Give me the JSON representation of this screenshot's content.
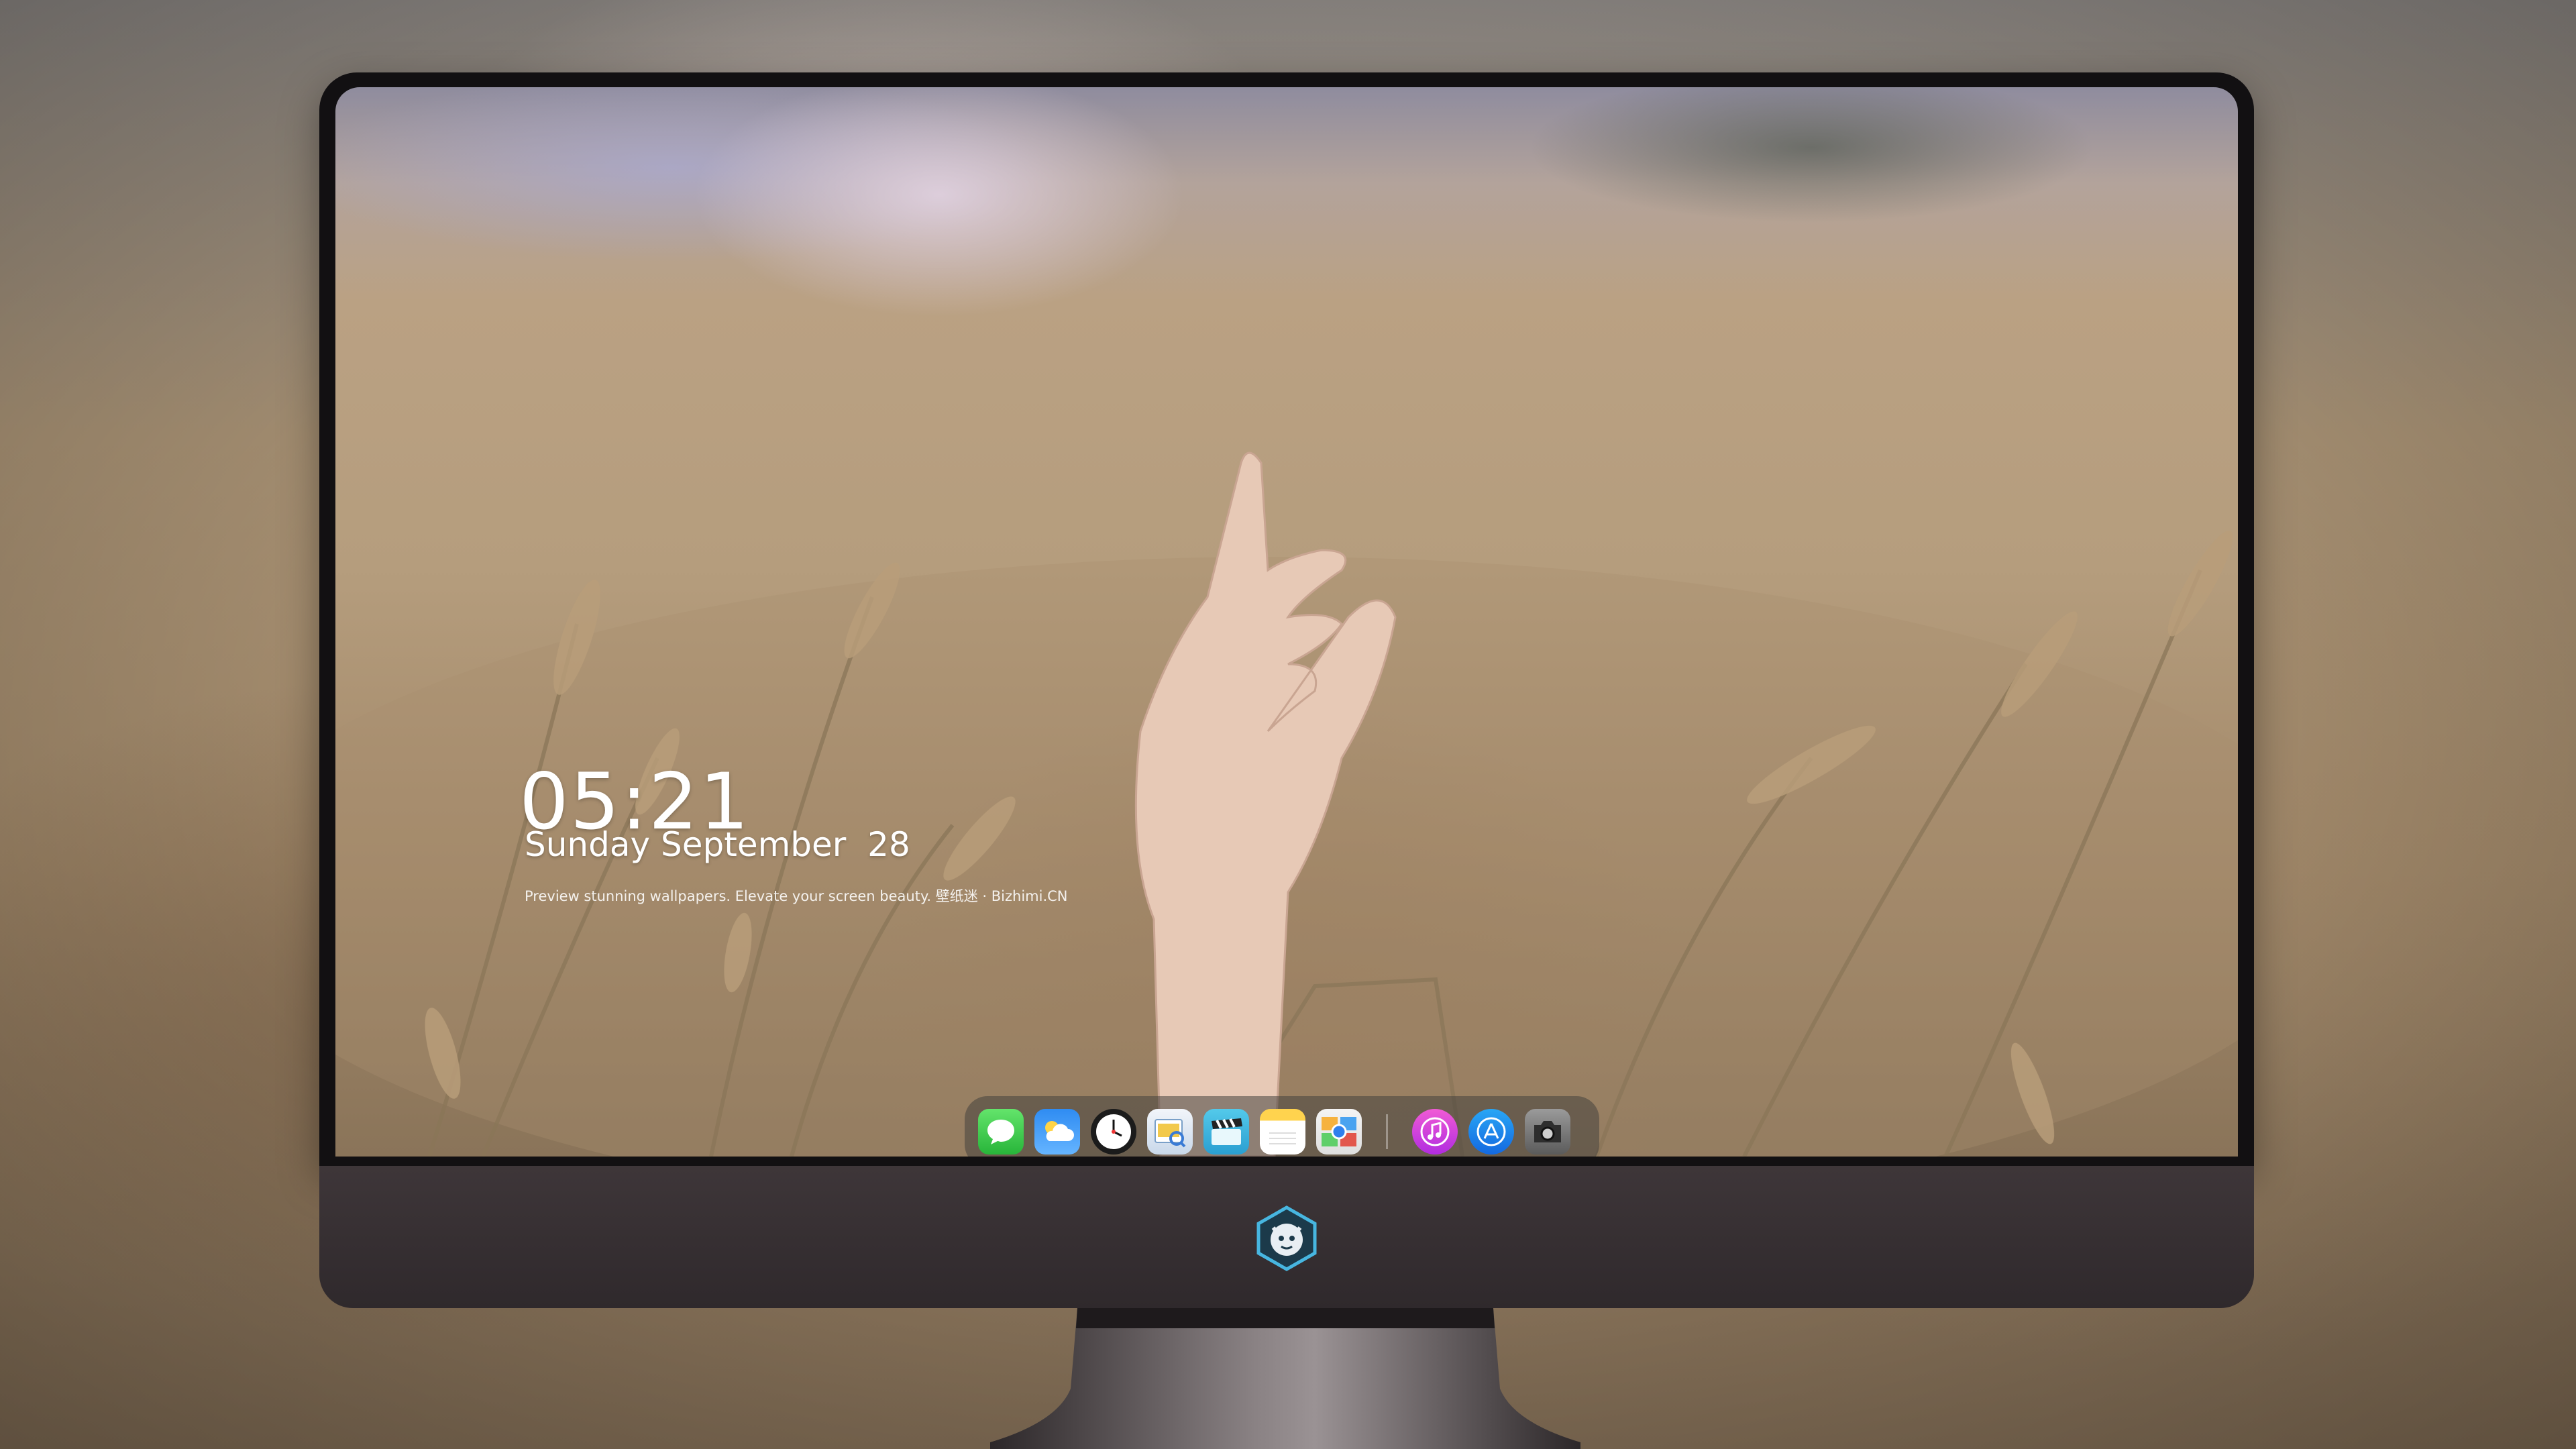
{
  "lock_screen": {
    "time": "05:21",
    "date": "Sunday September  28",
    "tagline": "Preview stunning wallpapers. Elevate your screen beauty. 壁纸迷 · Bizhimi.CN"
  },
  "dock": {
    "apps": [
      {
        "name": "Messages",
        "icon": "messages-icon"
      },
      {
        "name": "Weather",
        "icon": "weather-icon"
      },
      {
        "name": "Clock",
        "icon": "clock-icon"
      },
      {
        "name": "Preview",
        "icon": "preview-icon"
      },
      {
        "name": "Video",
        "icon": "clapperboard-icon"
      },
      {
        "name": "Notes",
        "icon": "notes-icon"
      },
      {
        "name": "Photo Gallery",
        "icon": "photos-icon"
      },
      {
        "name": "Music",
        "icon": "music-icon"
      },
      {
        "name": "App Store",
        "icon": "app-store-icon"
      },
      {
        "name": "Camera",
        "icon": "camera-icon"
      }
    ]
  },
  "colors": {
    "bezel": "#121012",
    "chin": "#3a3235",
    "dock_bg": "rgba(70,65,62,0.55)",
    "clock_text": "#ffffff"
  }
}
